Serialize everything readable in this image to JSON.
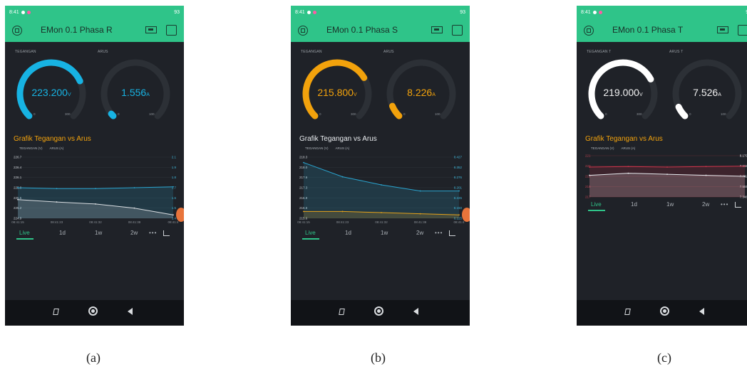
{
  "status": {
    "time": "8:41",
    "battery": "93"
  },
  "panels": [
    {
      "id": "a",
      "title": "EMon 0.1 Phasa R",
      "accent": "#17b3e3",
      "g1": {
        "label": "TEGANGAN",
        "value": "223.200",
        "unit": "V",
        "min": "0",
        "max": "300",
        "level": 0.744
      },
      "g2": {
        "label": "ARUS",
        "value": "1.556",
        "unit": "A",
        "min": "0",
        "max": "100",
        "level": 0.0156
      },
      "chart_title": "Grafik Tegangan vs Arus",
      "legend": [
        "TEGANGAN (V)",
        "ARUS (A)"
      ],
      "y_left": [
        "226.7",
        "226.4",
        "226.1",
        "225.8",
        "225.5",
        "225.2",
        "224.9"
      ],
      "y_right": [
        "2.1",
        "1.9",
        "1.8",
        "1.7",
        "1.6",
        "1.5",
        "1.4"
      ],
      "x_ticks": [
        "08:41:15",
        "08:41:23",
        "08:41:32",
        "08:41:38",
        "08:41:4"
      ],
      "series_tegangan": [
        225.45,
        225.38,
        225.32,
        225.2,
        225.0
      ],
      "series_arus": [
        1.75,
        1.74,
        1.74,
        1.75,
        1.76
      ],
      "tabs": [
        "Live",
        "1d",
        "1w",
        "2w",
        "•••"
      ],
      "caption": "(a)"
    },
    {
      "id": "b",
      "title": "EMon 0.1 Phasa S",
      "accent": "#f2a20c",
      "g1": {
        "label": "TEGANGAN",
        "value": "215.800",
        "unit": "V",
        "min": "0",
        "max": "300",
        "level": 0.719
      },
      "g2": {
        "label": "ARUS",
        "value": "8.226",
        "unit": "A",
        "min": "0",
        "max": "100",
        "level": 0.082
      },
      "chart_title": "Grafik Tegangan vs Arus",
      "legend": [
        "TEGANGAN (V)",
        "ARUS (A)"
      ],
      "y_left": [
        "218.3",
        "218.0",
        "217.6",
        "217.3",
        "216.9",
        "216.6",
        "215.6"
      ],
      "y_right": [
        "8.427",
        "8.352",
        "8.276",
        "8.201",
        "8.226",
        "8.150",
        "8.125"
      ],
      "x_ticks": [
        "08:41:15",
        "08:41:23",
        "08:41:32",
        "08:41:38",
        "08:41:4"
      ],
      "series_tegangan": [
        215.9,
        215.9,
        215.85,
        215.8,
        215.75
      ],
      "series_arus": [
        8.4,
        8.33,
        8.29,
        8.26,
        8.26
      ],
      "tabs": [
        "Live",
        "1d",
        "1w",
        "2w",
        "•••"
      ],
      "caption": "(b)"
    },
    {
      "id": "c",
      "title": "EMon 0.1 Phasa T",
      "accent": "#ffffff",
      "g1": {
        "label": "TEGANGAN T",
        "value": "219.000",
        "unit": "V",
        "min": "0",
        "max": "300",
        "level": 0.73
      },
      "g2": {
        "label": "ARUS T",
        "value": "7.526",
        "unit": "A",
        "min": "0",
        "max": "100",
        "level": 0.075
      },
      "chart_title": "Grafik Tegangan vs Arus",
      "legend": [
        "TEGANGAN (V)",
        "ARUS (A)"
      ],
      "y_left": [
        "221",
        "220",
        "219",
        "218",
        "217"
      ],
      "y_right": [
        "8.179",
        "7.968",
        "7.762",
        "7.555",
        "7.348"
      ],
      "x_ticks": [],
      "series_tegangan": [
        219.1,
        219.3,
        219.2,
        219.1,
        219.0
      ],
      "series_arus": [
        7.95,
        7.96,
        7.95,
        7.96,
        7.97
      ],
      "tabs": [
        "Live",
        "1d",
        "1w",
        "2w",
        "•••"
      ],
      "caption": "(c)"
    }
  ]
}
